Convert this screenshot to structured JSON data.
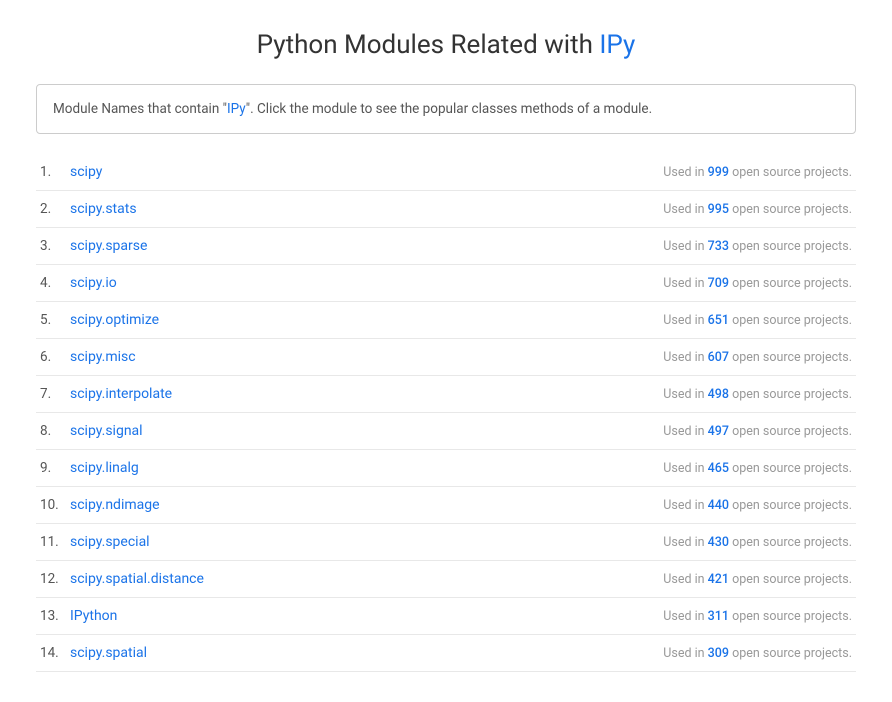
{
  "header": {
    "title_prefix": "Python Modules Related with ",
    "title_highlight": "IPy"
  },
  "info_box": {
    "text_prefix": "Module Names that contain \"",
    "link_text": "IPy",
    "text_suffix": "\". Click the module to see the popular classes methods of a module."
  },
  "modules": [
    {
      "number": "1.",
      "name": "scipy",
      "count": "999"
    },
    {
      "number": "2.",
      "name": "scipy.stats",
      "count": "995"
    },
    {
      "number": "3.",
      "name": "scipy.sparse",
      "count": "733"
    },
    {
      "number": "4.",
      "name": "scipy.io",
      "count": "709"
    },
    {
      "number": "5.",
      "name": "scipy.optimize",
      "count": "651"
    },
    {
      "number": "6.",
      "name": "scipy.misc",
      "count": "607"
    },
    {
      "number": "7.",
      "name": "scipy.interpolate",
      "count": "498"
    },
    {
      "number": "8.",
      "name": "scipy.signal",
      "count": "497"
    },
    {
      "number": "9.",
      "name": "scipy.linalg",
      "count": "465"
    },
    {
      "number": "10.",
      "name": "scipy.ndimage",
      "count": "440"
    },
    {
      "number": "11.",
      "name": "scipy.special",
      "count": "430"
    },
    {
      "number": "12.",
      "name": "scipy.spatial.distance",
      "count": "421"
    },
    {
      "number": "13.",
      "name": "IPython",
      "count": "311"
    },
    {
      "number": "14.",
      "name": "scipy.spatial",
      "count": "309"
    }
  ],
  "usage_prefix": "Used in ",
  "usage_suffix": " open source projects."
}
